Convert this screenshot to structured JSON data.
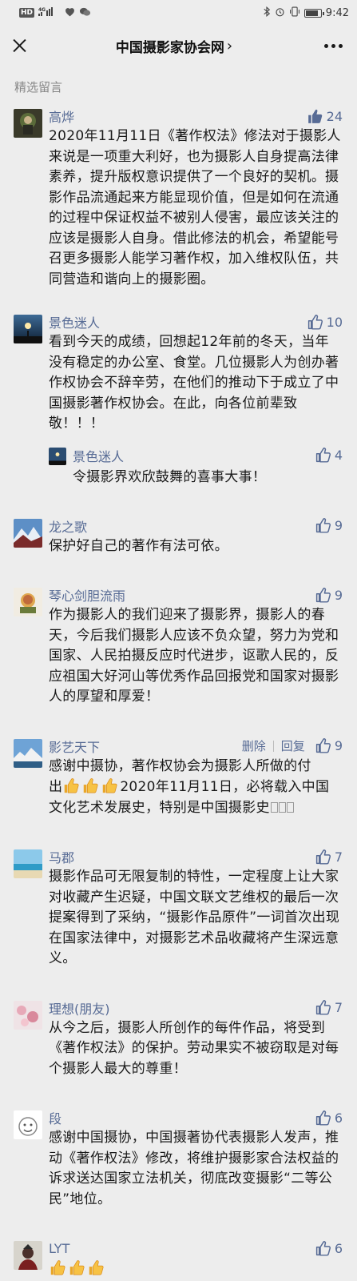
{
  "status_bar": {
    "left_badge": "HD",
    "network": "4G",
    "time": "9:42"
  },
  "nav": {
    "title": "中国摄影家协会网",
    "title_chevron": "›"
  },
  "section_title": "精选留言",
  "comments": [
    {
      "name": "高烨",
      "likes": "24",
      "liked": true,
      "text": "2020年11月11日《著作权法》修法对于摄影人来说是一项重大利好，也为摄影人自身提高法律素养，提升版权意识提供了一个良好的契机。摄影作品流通起来方能显现价值，但是如何在流通的过程中保证权益不被别人侵害，最应该关注的应该是摄影人自身。借此修法的机会，希望能号召更多摄影人能学习著作权，加入维权队伍，共同营造和谐向上的摄影圈。"
    },
    {
      "name": "景色迷人",
      "likes": "10",
      "text": "看到今天的成绩，回想起12年前的冬天，当年没有稳定的办公室、食堂。几位摄影人为创办著作权协会不辞辛劳，在他们的推动下于成立了中国摄影著作权协会。在此，向各位前辈致敬！！！",
      "reply": {
        "name": "景色迷人",
        "likes": "4",
        "text": "令摄影界欢欣鼓舞的喜事大事！"
      }
    },
    {
      "name": "龙之歌",
      "likes": "9",
      "text": "保护好自己的著作有法可依。"
    },
    {
      "name": "琴心剑胆流雨",
      "likes": "9",
      "text": "作为摄影人的我们迎来了摄影界，摄影人的春天，今后我们摄影人应该不负众望，努力为党和国家、人民拍摄反应时代进步，讴歌人民的，反应祖国大好河山等优秀作品回报党和国家对摄影人的厚望和厚爱！"
    },
    {
      "name": "影艺天下",
      "likes": "9",
      "delete_label": "删除",
      "reply_label": "回复",
      "text_line1": "感谢中摄协，著作权协会为摄影人所做的付",
      "text_prefix2": "出",
      "text_rest": "2020年11月11日，必将载入中国文化艺术发展史，特别是中国摄影史"
    },
    {
      "name": "马郡",
      "likes": "7",
      "text": "摄影作品可无限复制的特性，一定程度上让大家对收藏产生迟疑，中国文联文艺维权的最后一次提案得到了采纳，“摄影作品原件”一词首次出现在国家法律中，对摄影艺术品收藏将产生深远意义。"
    },
    {
      "name": "理想(朋友)",
      "likes": "7",
      "text": "从今之后，摄影人所创作的每件作品，将受到《著作权法》的保护。劳动果实不被窃取是对每个摄影人最大的尊重！"
    },
    {
      "name": "段",
      "likes": "6",
      "text": "感谢中国摄协，中国摄著协代表摄影人发声，推动《著作权法》修改，将维护摄影家合法权益的诉求送达国家立法机关，彻底改变摄影“二等公民”地位。"
    },
    {
      "name": "LYT",
      "likes": "6"
    }
  ],
  "icons": {
    "close": "close-icon",
    "more": "more-icon",
    "like": "thumbs-up-icon",
    "emoji": "thumbs-up-emoji"
  },
  "colors": {
    "background": "#ededed",
    "name_link": "#576b95",
    "text": "#1a1a1a",
    "section_title": "#888888"
  }
}
